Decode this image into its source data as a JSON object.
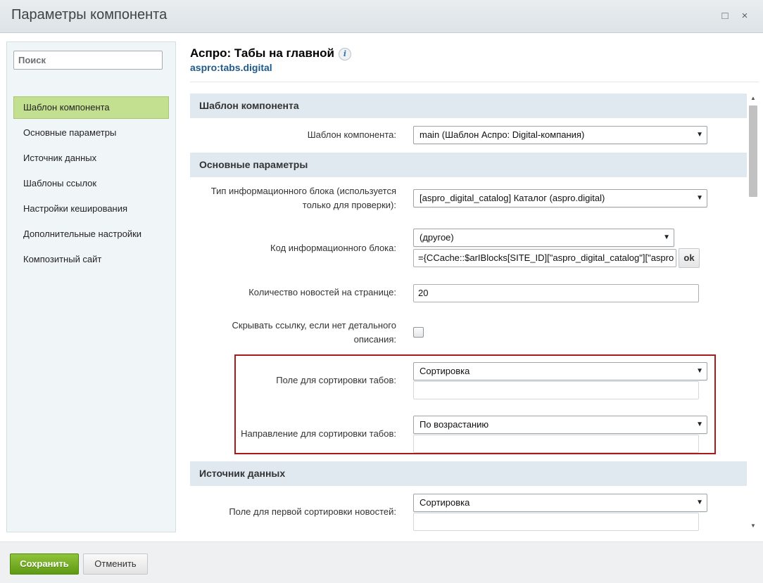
{
  "window": {
    "title": "Параметры компонента",
    "maximize_icon": "□",
    "close_icon": "×"
  },
  "sidebar": {
    "search_placeholder": "Поиск",
    "items": [
      {
        "label": "Шаблон компонента",
        "active": true
      },
      {
        "label": "Основные параметры"
      },
      {
        "label": "Источник данных"
      },
      {
        "label": "Шаблоны ссылок"
      },
      {
        "label": "Настройки кеширования"
      },
      {
        "label": "Дополнительные настройки"
      },
      {
        "label": "Композитный сайт"
      }
    ]
  },
  "component": {
    "title": "Аспро: Табы на главной",
    "info_icon": "i",
    "code": "aspro:tabs.digital"
  },
  "sections": {
    "template": "Шаблон компонента",
    "main": "Основные параметры",
    "source": "Источник данных"
  },
  "params": {
    "template": {
      "label": "Шаблон компонента:",
      "value": "main (Шаблон Аспро: Digital-компания)"
    },
    "iblock_type": {
      "label_line1": "Тип информационного блока (используется",
      "label_line2": "только для проверки):",
      "value": "[aspro_digital_catalog] Каталог (aspro.digital)"
    },
    "iblock_code": {
      "label": "Код информационного блока:",
      "select_value": "(другое)",
      "text_value": "={CCache::$arIBlocks[SITE_ID][\"aspro_digital_catalog\"][\"aspro",
      "ok_label": "ok"
    },
    "news_count": {
      "label": "Количество новостей на странице:",
      "value": "20"
    },
    "hide_link": {
      "label_line1": "Скрывать ссылку, если нет детального",
      "label_line2": "описания:",
      "checked": false
    },
    "tab_sort_field": {
      "label": "Поле для сортировки табов:",
      "value": "Сортировка"
    },
    "tab_sort_order": {
      "label": "Направление для сортировки табов:",
      "value": "По возрастанию"
    },
    "news_sort_field1": {
      "label": "Поле для первой сортировки новостей:",
      "value": "Сортировка"
    }
  },
  "footer": {
    "save_label": "Сохранить",
    "cancel_label": "Отменить"
  },
  "colors": {
    "accent_green": "#8fc43a",
    "active_nav": "#c3e090",
    "highlight_border": "#a61b1b",
    "section_bg": "#e0e9f0",
    "link_blue": "#1f5a8a"
  }
}
